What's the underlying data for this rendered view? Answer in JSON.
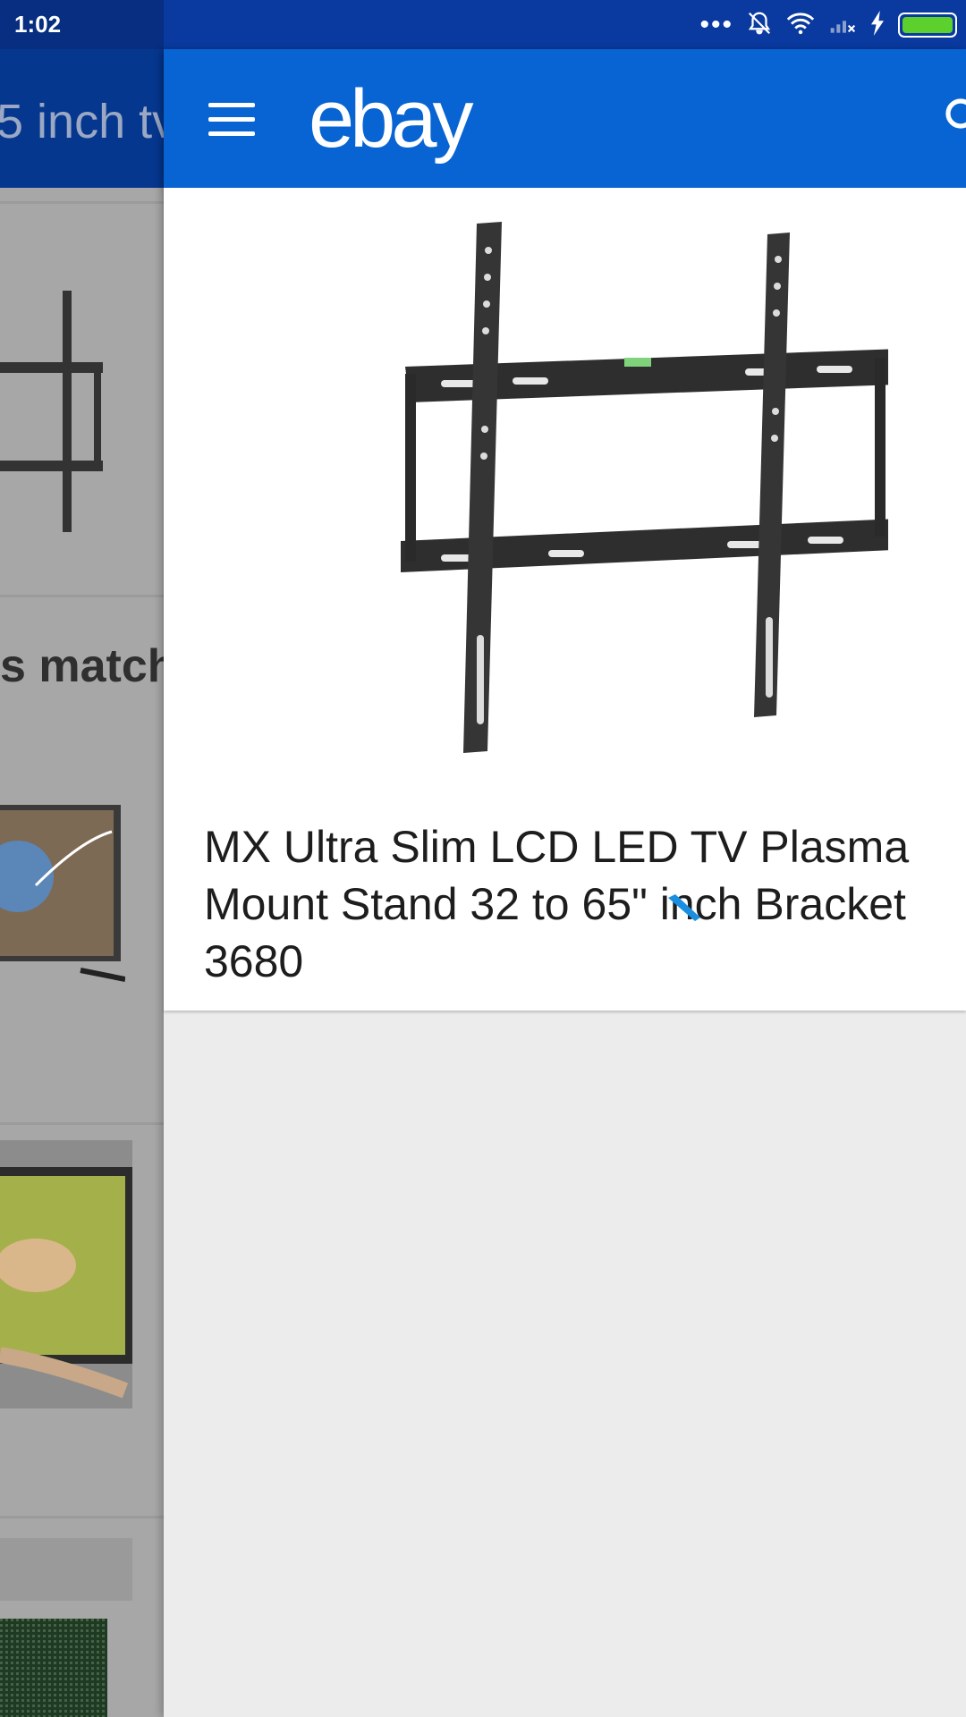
{
  "status_bar": {
    "time": "1:02",
    "icons": [
      "more-dots-icon",
      "bell-muted-icon",
      "wifi-icon",
      "signal-off-icon",
      "charging-icon",
      "battery-icon"
    ]
  },
  "background_page": {
    "query_text": "5 inch tv",
    "heading_fragment": "s match"
  },
  "app_bar": {
    "logo": "ebay",
    "icons": [
      "menu-icon",
      "search-icon"
    ]
  },
  "product": {
    "title": "MX Ultra Slim LCD LED TV Plasma\nMount Stand 32 to 65\" inch Bracket\n3680"
  },
  "colors": {
    "status_bar": "#0a3aa0",
    "app_bar": "#0864d2",
    "battery": "#5cd12d",
    "panel_bg": "#ececec"
  }
}
